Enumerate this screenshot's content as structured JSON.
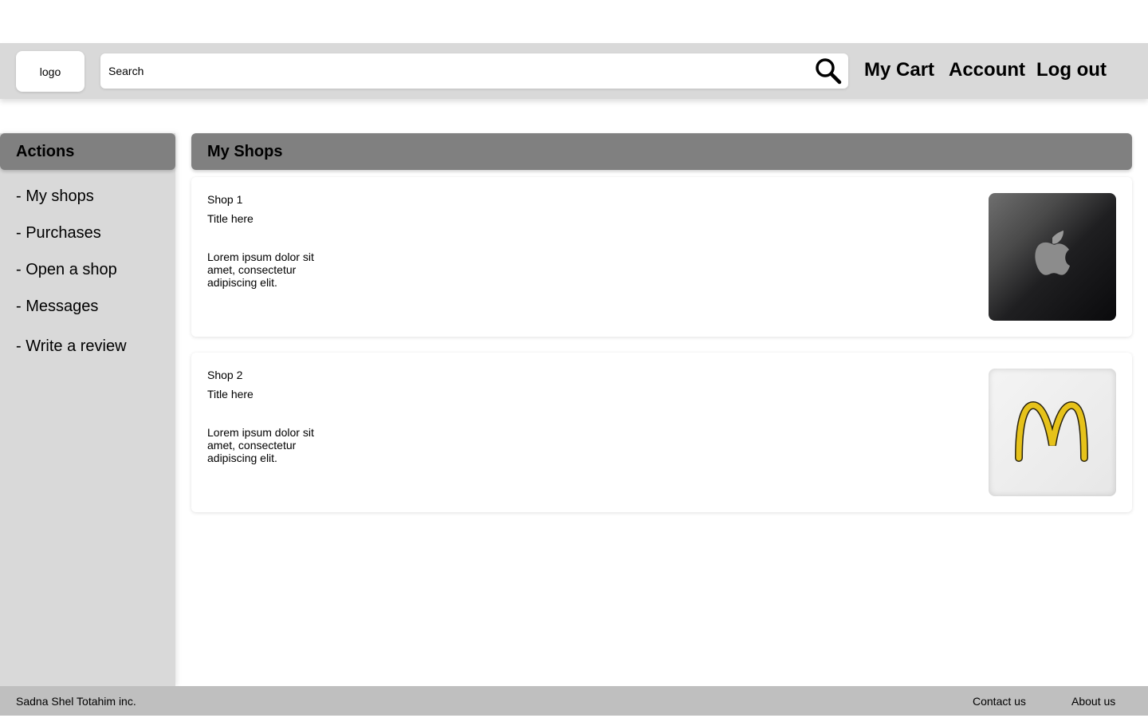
{
  "header": {
    "logo_text": "logo",
    "search_placeholder": "Search",
    "search_icon": "search-icon",
    "nav": {
      "cart": "My Cart",
      "account": "Account",
      "logout": "Log out"
    }
  },
  "sidebar": {
    "title": "Actions",
    "items": [
      {
        "label": "- My shops"
      },
      {
        "label": "- Purchases"
      },
      {
        "label": "- Open a shop"
      },
      {
        "label": "- Messages"
      },
      {
        "label": "- Write a review"
      }
    ]
  },
  "main": {
    "title": "My Shops",
    "shops": [
      {
        "name": "Shop 1",
        "title": "Title here",
        "description": "Lorem ipsum dolor sit amet, consectetur adipiscing elit.",
        "image_icon": "apple-logo-icon"
      },
      {
        "name": "Shop 2",
        "title": "Title here",
        "description": "Lorem ipsum dolor sit amet, consectetur adipiscing elit.",
        "image_icon": "mcdonalds-logo-icon"
      }
    ]
  },
  "footer": {
    "copyright": "Sadna Shel Totahim inc.",
    "contact": "Contact us",
    "about": "About us"
  },
  "colors": {
    "header_bg": "#d9d9d9",
    "section_header_bg": "#808080",
    "footer_bg": "#bfbfbf",
    "card_bg": "#ffffff"
  }
}
